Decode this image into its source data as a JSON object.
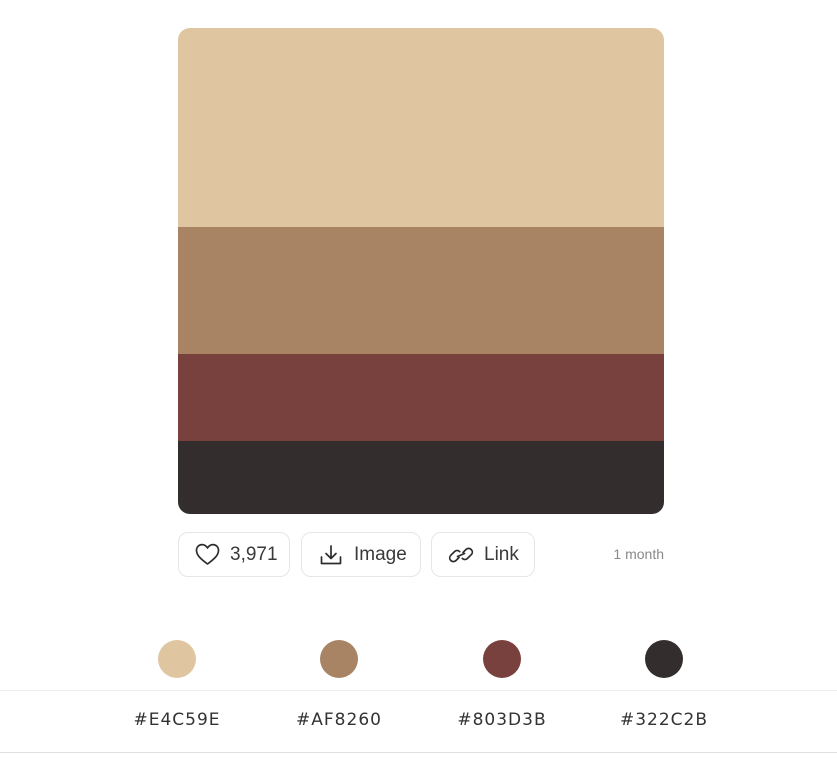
{
  "palette": {
    "colors": [
      {
        "hex": "#E4C59E",
        "display": "#E4C59E",
        "swatch": "#DFC6A1"
      },
      {
        "hex": "#AF8260",
        "display": "#AF8260",
        "swatch": "#A88464"
      },
      {
        "hex": "#803D3B",
        "display": "#803D3B",
        "swatch": "#78413D"
      },
      {
        "hex": "#322C2B",
        "display": "#322C2B",
        "swatch": "#332D2D"
      }
    ]
  },
  "actions": {
    "likes": "3,971",
    "image_label": "Image",
    "link_label": "Link",
    "timestamp": "1 month"
  },
  "icons": {
    "like": "heart-icon",
    "image": "download-icon",
    "link": "link-icon"
  }
}
